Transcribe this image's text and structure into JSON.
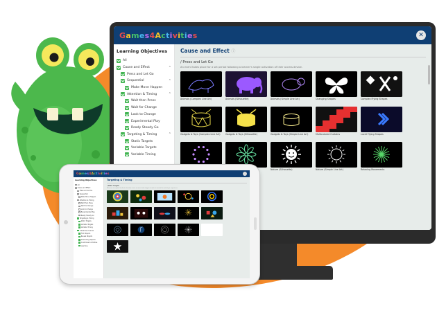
{
  "brand": "Games4Activities",
  "colors": {
    "accent": "#0f3f74",
    "check": "#43b553",
    "background_blob": "#f48a2a",
    "content_bg": "#e7ecea"
  },
  "desktop": {
    "sidebar": {
      "title": "Learning Objectives",
      "items": [
        {
          "label": "All",
          "level": 1,
          "expand": false
        },
        {
          "label": "Cause and Effect",
          "level": 1,
          "expand": true
        },
        {
          "label": "Press and Let Go",
          "level": 2,
          "expand": false
        },
        {
          "label": "Sequential",
          "level": 2,
          "expand": true
        },
        {
          "label": "Make Move Happen",
          "level": 3,
          "expand": false
        },
        {
          "label": "Attention & Timing",
          "level": 2,
          "expand": true
        },
        {
          "label": "Wait then Press",
          "level": 3,
          "expand": false
        },
        {
          "label": "Wait for Change",
          "level": 3,
          "expand": false
        },
        {
          "label": "Look to Change",
          "level": 3,
          "expand": false
        },
        {
          "label": "Experimental Play",
          "level": 3,
          "expand": false
        },
        {
          "label": "Ready Steady Go",
          "level": 3,
          "expand": false
        },
        {
          "label": "Targeting & Timing",
          "level": 2,
          "expand": true
        },
        {
          "label": "Static Targets",
          "level": 3,
          "expand": false
        },
        {
          "label": "Variable Targets",
          "level": 3,
          "expand": false
        },
        {
          "label": "Variable Timing",
          "level": 3,
          "expand": false
        }
      ]
    },
    "main": {
      "title": "Cause and Effect",
      "info_icon": "ⓘ",
      "section_title": "/ Press and Let Go",
      "description": "An event takes place for a set period following a learner's single activation of their access device.",
      "tiles": [
        {
          "caption": "Animals (Complex Line Art)",
          "icon": "animal-line-art"
        },
        {
          "caption": "Animals (Silhouette)",
          "icon": "elephant-silhouette"
        },
        {
          "caption": "Animals (Simple Line Art)",
          "icon": "animal-simple"
        },
        {
          "caption": "Changing Shapes",
          "icon": "butterfly"
        },
        {
          "caption": "Complex Flying Shapes",
          "icon": "flying-shapes"
        },
        {
          "caption": "Gadgets & Toys (Complex Line Art)",
          "icon": "drum"
        },
        {
          "caption": "Gadgets & Toys (Silhouette)",
          "icon": "drum-silhouette"
        },
        {
          "caption": "Gadgets & Toys (Simple Line Art)",
          "icon": "drum-simple"
        },
        {
          "caption": "Multicolored Curtains",
          "icon": "curtains"
        },
        {
          "caption": "Lucid Flying Shapes",
          "icon": "chevrons"
        },
        {
          "caption": "",
          "icon": "dots-circle"
        },
        {
          "caption": "Nature (Complex Line Art)",
          "icon": "flower"
        },
        {
          "caption": "Nature (Silhouette)",
          "icon": "sun"
        },
        {
          "caption": "Nature (Simple Line Art)",
          "icon": "sun-simple"
        },
        {
          "caption": "Relaxing Movements",
          "icon": "radial"
        }
      ]
    }
  },
  "tablet": {
    "sidebar": {
      "title": "Learning Objectives",
      "items": [
        {
          "label": "All",
          "level": 1,
          "checked": false
        },
        {
          "label": "Cause and Effect",
          "level": 1,
          "checked": false
        },
        {
          "label": "Press and Let Go",
          "level": 2,
          "checked": false
        },
        {
          "label": "Sequential",
          "level": 2,
          "checked": false
        },
        {
          "label": "Make Move Happen",
          "level": 3,
          "checked": false
        },
        {
          "label": "Attention & Timing",
          "level": 2,
          "checked": false
        },
        {
          "label": "Wait then Press",
          "level": 3,
          "checked": false
        },
        {
          "label": "Wait for Change",
          "level": 3,
          "checked": false
        },
        {
          "label": "Look to Change",
          "level": 3,
          "checked": false
        },
        {
          "label": "Experimental Play",
          "level": 3,
          "checked": false
        },
        {
          "label": "Ready Steady Go",
          "level": 3,
          "checked": false
        },
        {
          "label": "Targeting & Timing",
          "level": 2,
          "checked": true
        },
        {
          "label": "Static Targets",
          "level": 3,
          "checked": true
        },
        {
          "label": "Variable Targets",
          "level": 3,
          "checked": true
        },
        {
          "label": "Variable Timing",
          "level": 3,
          "checked": true
        },
        {
          "label": "Interactive Scenes",
          "level": 2,
          "checked": true
        },
        {
          "label": "Find Objects",
          "level": 3,
          "checked": true
        },
        {
          "label": "Reveal Objects",
          "level": 3,
          "checked": true
        },
        {
          "label": "Interacting Objects",
          "level": 3,
          "checked": true
        },
        {
          "label": "Customised Activities",
          "level": 3,
          "checked": true
        },
        {
          "label": "Learning",
          "level": 3,
          "checked": true
        }
      ]
    },
    "main": {
      "title": "Targeting & Timing",
      "section_title": "/ Static Targets",
      "description": "A learner is required to direct attention to one or more static targets in order to control the activity or experience.",
      "tiles": [
        {
          "caption": "Aim & Shoot",
          "icon": "target"
        },
        {
          "caption": "Bouncing Balls",
          "icon": "balls"
        },
        {
          "caption": "Catch & Hit",
          "icon": "catch"
        },
        {
          "caption": "Colour Match",
          "icon": "bubbles"
        },
        {
          "caption": "Animated Targets",
          "icon": "rings"
        },
        {
          "caption": "Bricks & Blocks",
          "icon": "blocks"
        },
        {
          "caption": "Count Together",
          "icon": "count"
        },
        {
          "caption": "Drum Kit",
          "icon": "drums"
        },
        {
          "caption": "Fun Fireworks",
          "icon": "fireworks"
        },
        {
          "caption": "Happy Shapes",
          "icon": "shapes"
        },
        {
          "caption": "Fiery Targets",
          "icon": "fiery"
        },
        {
          "caption": "Make Music",
          "icon": "music"
        },
        {
          "caption": "Space Blast",
          "icon": "space"
        },
        {
          "caption": "Spin It",
          "icon": "spin"
        },
        {
          "caption": "",
          "icon": ""
        },
        {
          "caption": "Star Burst",
          "icon": "star"
        }
      ]
    }
  }
}
